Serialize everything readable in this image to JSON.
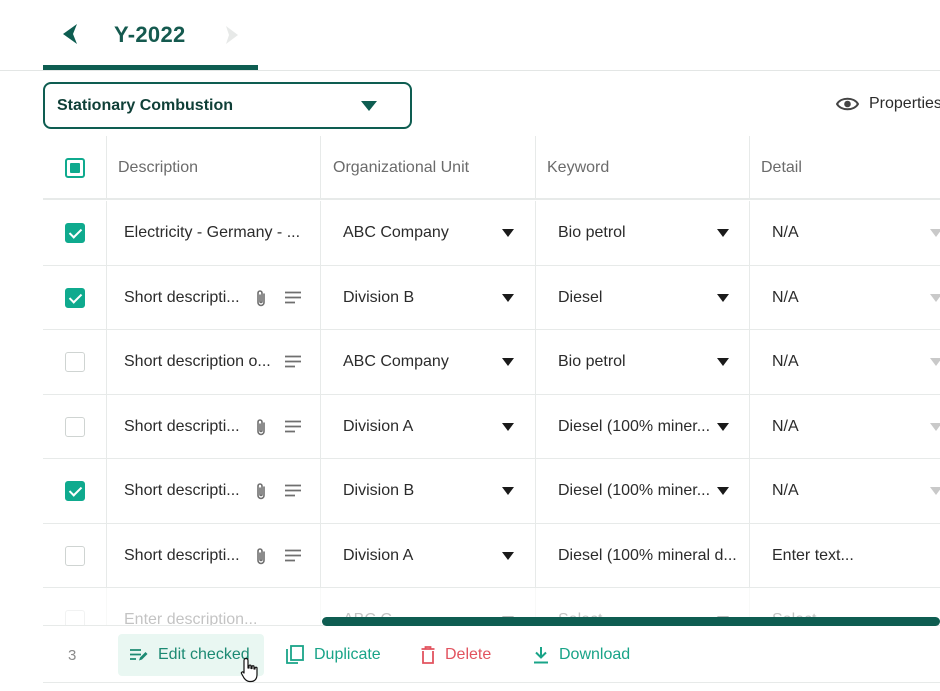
{
  "year_selector": {
    "label": "Y-2022"
  },
  "category": {
    "selected": "Stationary Combustion"
  },
  "properties_label": "Properties",
  "table": {
    "headers": {
      "description": "Description",
      "org_unit": "Organizational Unit",
      "keyword": "Keyword",
      "detail": "Detail"
    },
    "rows": [
      {
        "checked": true,
        "description": "Electricity - Germany - ...",
        "attach": false,
        "note": false,
        "org_unit": "ABC Company",
        "keyword": "Bio petrol",
        "detail": "N/A"
      },
      {
        "checked": true,
        "description": "Short descripti...",
        "attach": true,
        "note": true,
        "org_unit": "Division B",
        "keyword": "Diesel",
        "detail": "N/A"
      },
      {
        "checked": false,
        "description": "Short description o...",
        "attach": false,
        "note": true,
        "org_unit": "ABC Company",
        "keyword": "Bio petrol",
        "detail": "N/A"
      },
      {
        "checked": false,
        "description": "Short descripti...",
        "attach": true,
        "note": true,
        "org_unit": "Division A",
        "keyword": "Diesel (100% miner...",
        "detail": "N/A"
      },
      {
        "checked": true,
        "description": "Short descripti...",
        "attach": true,
        "note": true,
        "org_unit": "Division B",
        "keyword": "Diesel (100% miner...",
        "detail": "N/A"
      },
      {
        "checked": false,
        "description": "Short descripti...",
        "attach": true,
        "note": true,
        "org_unit": "Division A",
        "keyword": "Diesel (100% mineral d...",
        "detail": "Enter text..."
      },
      {
        "checked": false,
        "description": "Enter description...",
        "attach": false,
        "note": false,
        "org_unit": "ABC C...",
        "keyword": "Select...",
        "detail": "Select..."
      }
    ]
  },
  "footer": {
    "checked_count": "3",
    "edit_label": "Edit checked",
    "duplicate_label": "Duplicate",
    "delete_label": "Delete",
    "download_label": "Download"
  },
  "colors": {
    "accent": "#0e5d51",
    "check": "#0faa8e",
    "danger": "#e2535f"
  }
}
